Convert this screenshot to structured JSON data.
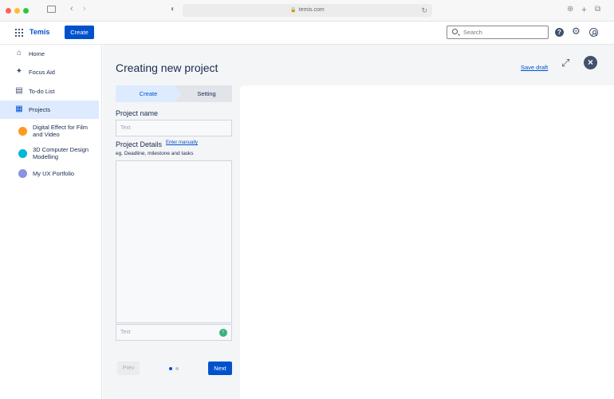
{
  "browser": {
    "url": "temis.com",
    "icons": [
      "sidebar-icon",
      "back-icon",
      "forward-icon",
      "shield-icon",
      "lock-icon",
      "reload-icon",
      "download-icon",
      "new-tab-icon",
      "tabs-icon"
    ]
  },
  "header": {
    "brand": "Temis",
    "create_label": "Create",
    "search_placeholder": "Search",
    "icons": [
      "apps-grid-icon",
      "search-icon",
      "help-icon",
      "gear-icon",
      "avatar-icon"
    ]
  },
  "sidebar": {
    "nav": [
      {
        "label": "Home",
        "icon": "home-icon"
      },
      {
        "label": "Focus Aid",
        "icon": "sparkle-icon"
      },
      {
        "label": "To-do List",
        "icon": "document-icon"
      },
      {
        "label": "Projects",
        "icon": "projects-icon",
        "active": true
      }
    ],
    "projects": [
      {
        "label": "Digital Effect for Film and Video",
        "color": "#ff991f"
      },
      {
        "label": "3D Computer Design Modelling",
        "color": "#00b8d9"
      },
      {
        "label": "My UX Portfolio",
        "color": "#8993e0"
      }
    ]
  },
  "main": {
    "title": "Creating new project",
    "save_draft": "Save draft",
    "steps": [
      "Create",
      "Setting"
    ],
    "project_name_label": "Project name",
    "project_name_placeholder": "Text",
    "project_details_label": "Project Details",
    "enter_manually": "Enter manually",
    "details_hint": "eg. Deadline, milestone and tasks",
    "message_placeholder": "Text",
    "prev_label": "Prev",
    "next_label": "Next",
    "pagination": {
      "current": 1,
      "total": 2
    }
  },
  "colors": {
    "accent": "#0052cc",
    "active_bg": "#deebff",
    "send": "#36b37e"
  }
}
